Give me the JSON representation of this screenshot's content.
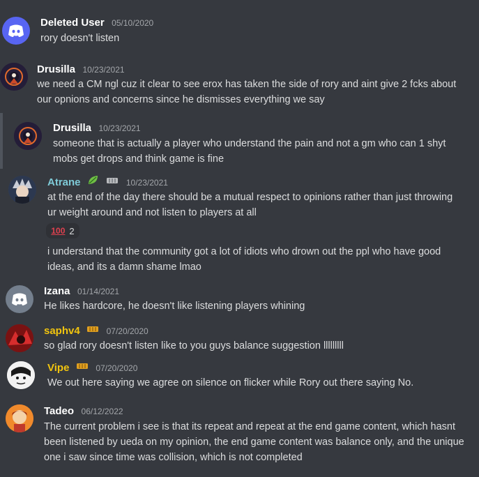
{
  "messages": [
    {
      "name": "Deleted User",
      "timestamp": "05/10/2020",
      "lines": [
        "rory doesn't listen"
      ],
      "name_color": "#ffffff"
    },
    {
      "name": "Drusilla",
      "timestamp": "10/23/2021",
      "lines": [
        "we need a CM ngl cuz it clear to see erox has taken the side of rory and aint give 2 fcks about",
        "our opnions and concerns since he dismisses everything we say"
      ],
      "name_color": "#ffffff"
    },
    {
      "name": "Drusilla",
      "timestamp": "10/23/2021",
      "lines": [
        "someone that is actually a player who understand the pain and not a gm who can 1 shyt",
        "mobs get drops and think game is fine"
      ],
      "name_color": "#ffffff"
    },
    {
      "name": "Atrane",
      "timestamp": "10/23/2021",
      "lines": [
        "at the end of the day there should be a mutual respect to opinions rather than just throwing",
        "ur weight around and not listen to players at all"
      ],
      "followup_lines": [
        "i understand that the community got a lot of idiots who drown out the ppl who have good",
        "ideas, and its a damn shame lmao"
      ],
      "name_color": "#7fcbd8",
      "reaction": {
        "emoji": "100",
        "count": "2"
      }
    },
    {
      "name": "Izana",
      "timestamp": "01/14/2021",
      "lines": [
        "He likes hardcore, he doesn't like listening players whining"
      ],
      "name_color": "#ffffff"
    },
    {
      "name": "saphv4",
      "timestamp": "07/20/2020",
      "lines": [
        "so glad rory doesn't listen like to you guys balance suggestion lllllllll"
      ],
      "name_color": "#f1c40f"
    },
    {
      "name": "Vipe",
      "timestamp": "07/20/2020",
      "lines": [
        "We out here saying we agree on silence on flicker while Rory out there saying No."
      ],
      "name_color": "#f1c40f"
    },
    {
      "name": "Tadeo",
      "timestamp": "06/12/2022",
      "lines": [
        "The current problem i see is that its repeat and repeat at the end game content, which hasnt",
        "been listened by ueda on my opinion, the end game content was balance only, and the unique",
        "one i saw since time was collision, which is not completed"
      ],
      "name_color": "#ffffff"
    }
  ],
  "icons": {
    "discord": "discord-logo-icon",
    "leaf": "leaf-badge-icon",
    "ticket": "ticket-badge-icon",
    "hundred": "hundred-points-emoji"
  },
  "colors": {
    "background": "#36393f",
    "discord_blurple": "#5865f2",
    "discord_grey": "#747f8d"
  }
}
